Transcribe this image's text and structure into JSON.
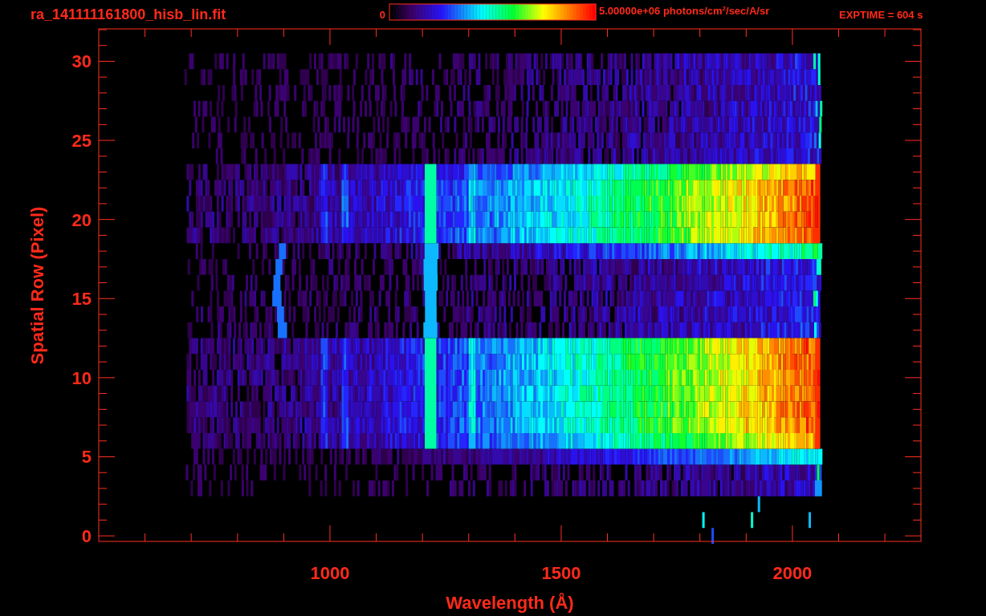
{
  "title": "ra_141111161800_hisb_lin.fit",
  "colorbar": {
    "min_label": "0",
    "max_label": "5.00000e+06 photons/cm$^{2}$/sec/A/sr"
  },
  "exposure": "EXPTIME = 604 s",
  "plot": {
    "xlabel": "Wavelength (Å)",
    "ylabel": "Spatial Row (Pixel)",
    "xtick_labels": [
      "1000",
      "1500",
      "2000"
    ],
    "ytick_labels": [
      "30",
      "25",
      "20",
      "15",
      "10",
      "5",
      "0"
    ]
  }
}
